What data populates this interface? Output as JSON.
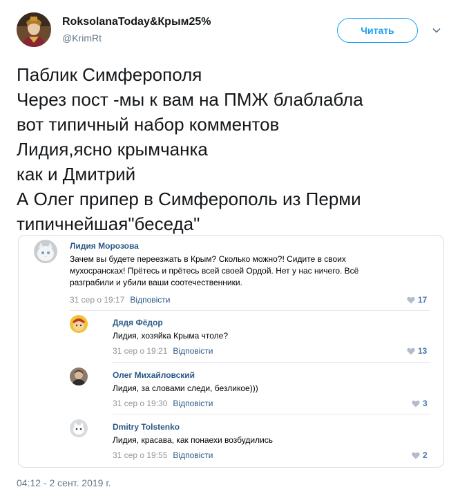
{
  "tweet": {
    "author_name": "RoksolanaToday&Крым25%",
    "author_handle": "@KrimRt",
    "follow_label": "Читать",
    "lines": [
      "Паблик Симферополя",
      "Через пост -мы к вам на ПМЖ блаблабла",
      "вот типичный набор комментов",
      "Лидия,ясно крымчанка",
      "как и Дмитрий",
      "А Олег припер в Симферополь из Перми",
      "типичнейшая\"беседа\""
    ],
    "timestamp": "04:12 - 2 сент. 2019 г."
  },
  "comments": [
    {
      "name": "Лидия Морозова",
      "text_lines": [
        "Зачем вы будете переезжать в Крым? Сколько можно?! Сидите в своих",
        "мухосрансках! Прётесь и прётесь всей своей Ордой. Нет у нас ничего. Всё",
        "разграбили и убили ваши соотечественники."
      ],
      "time": "31 сер о 19:17",
      "reply_label": "Відповісти",
      "likes": "17"
    },
    {
      "name": "Дядя Фёдор",
      "text_lines": [
        "Лидия, хозяйка Крыма чтоле?"
      ],
      "time": "31 сер о 19:21",
      "reply_label": "Відповісти",
      "likes": "13"
    },
    {
      "name": "Олег Михайловский",
      "text_lines": [
        "Лидия, за словами следи, безликое)))"
      ],
      "time": "31 сер о 19:30",
      "reply_label": "Відповісти",
      "likes": "3"
    },
    {
      "name": "Dmitry Tolstenko",
      "text_lines": [
        "Лидия, красава, как понаехи возбудились"
      ],
      "time": "31 сер о 19:55",
      "reply_label": "Відповісти",
      "likes": "2"
    }
  ],
  "colors": {
    "twitter_blue": "#1da1f2",
    "vk_link": "#2a5885",
    "vk_like": "#4a76a8",
    "muted": "#657786"
  },
  "icons": {
    "caret": "chevron-down-icon",
    "like": "heart-icon"
  }
}
